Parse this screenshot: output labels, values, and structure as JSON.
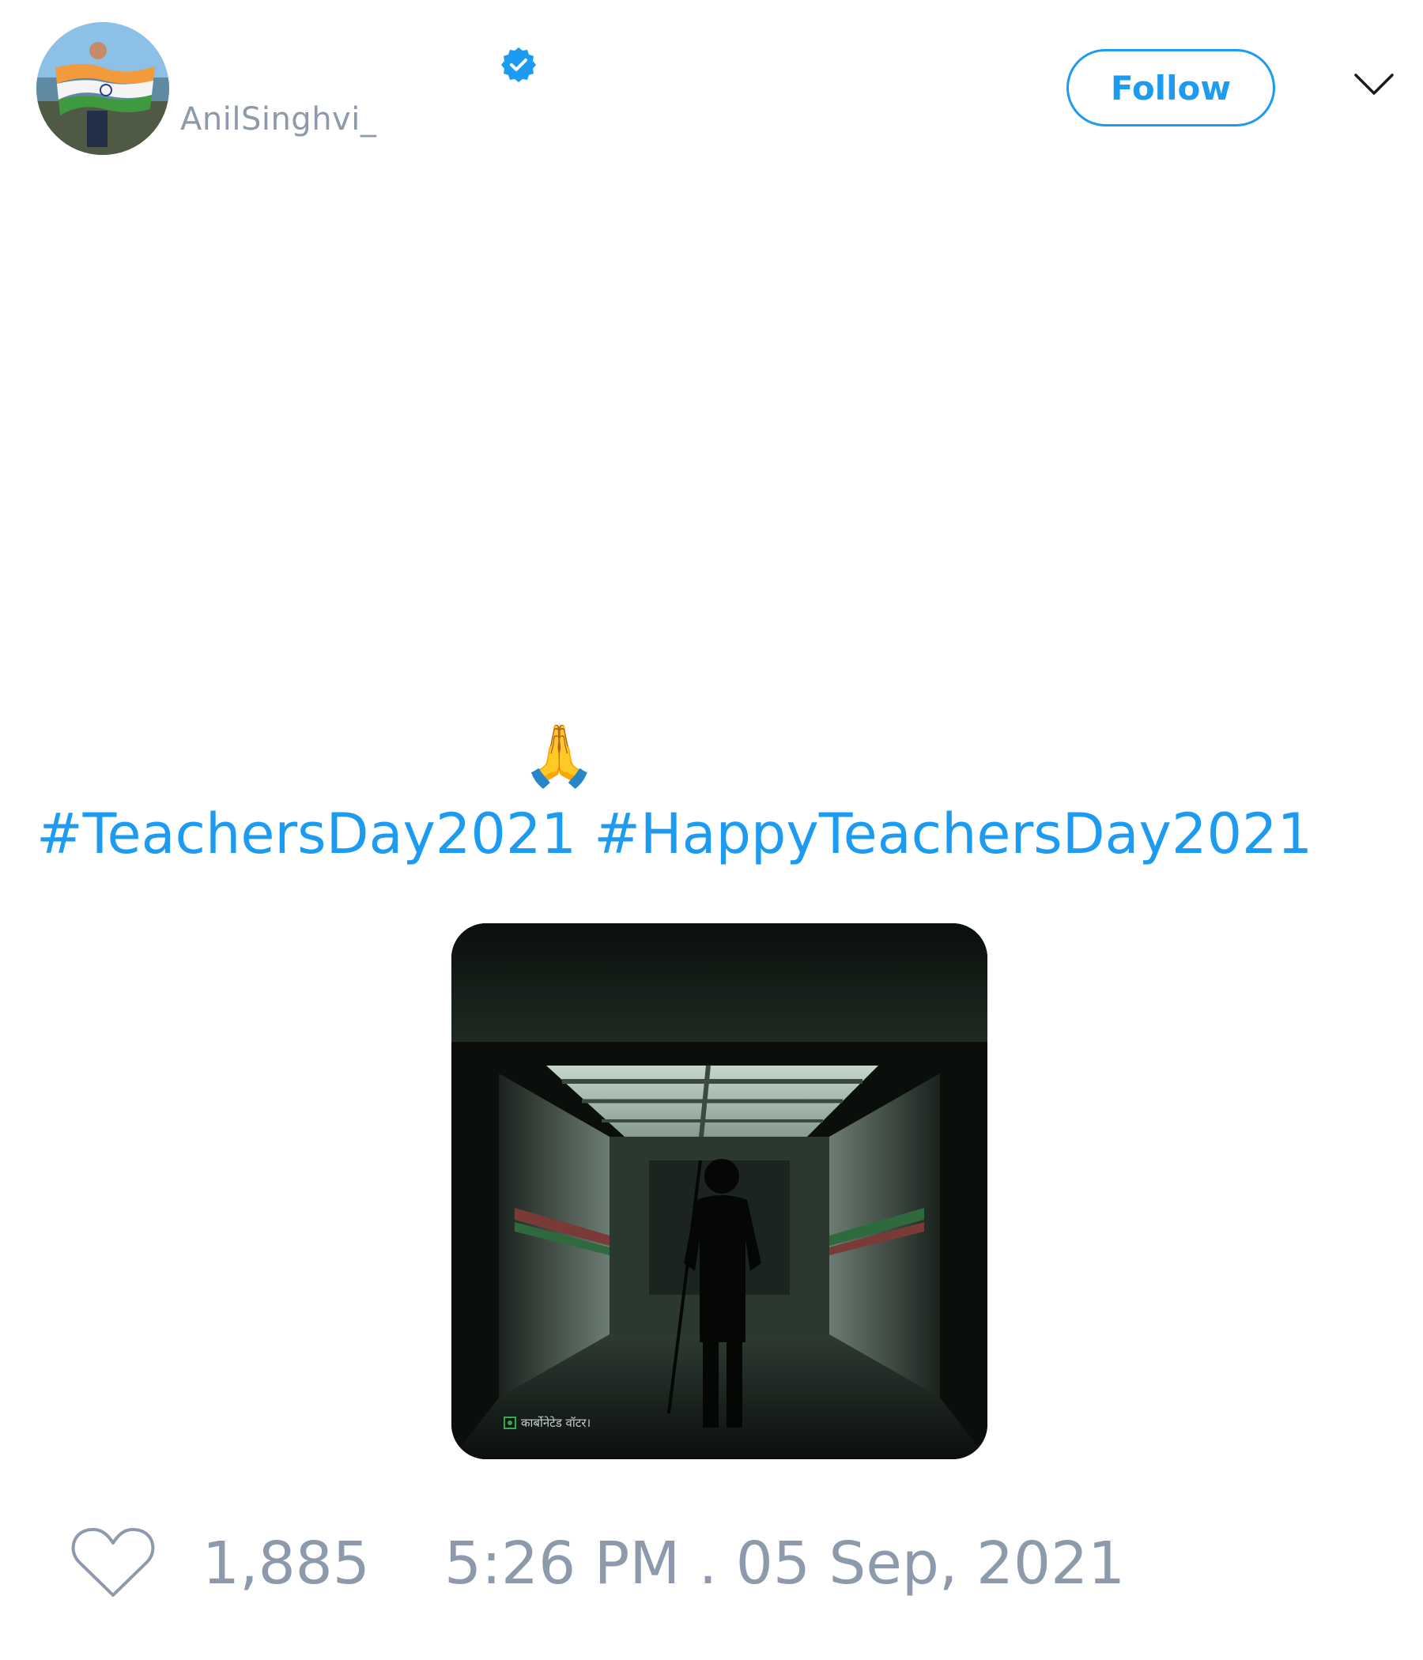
{
  "header": {
    "username": "AnilSinghvi_",
    "follow_label": "Follow",
    "verified_icon": "verified-badge-icon",
    "menu_icon": "chevron-down-icon"
  },
  "tweet": {
    "emoji": "🙏",
    "hashtags": [
      "#TeachersDay2021",
      "#HappyTeachersDay2021"
    ],
    "media": {
      "caption": "कार्बोनेटेड वॉटर।"
    }
  },
  "footer": {
    "likes": "1,885",
    "timestamp": "5:26 PM . 05 Sep, 2021",
    "heart_icon": "heart-icon"
  },
  "colors": {
    "accent": "#1d9bf0",
    "muted": "#8d9aab"
  }
}
